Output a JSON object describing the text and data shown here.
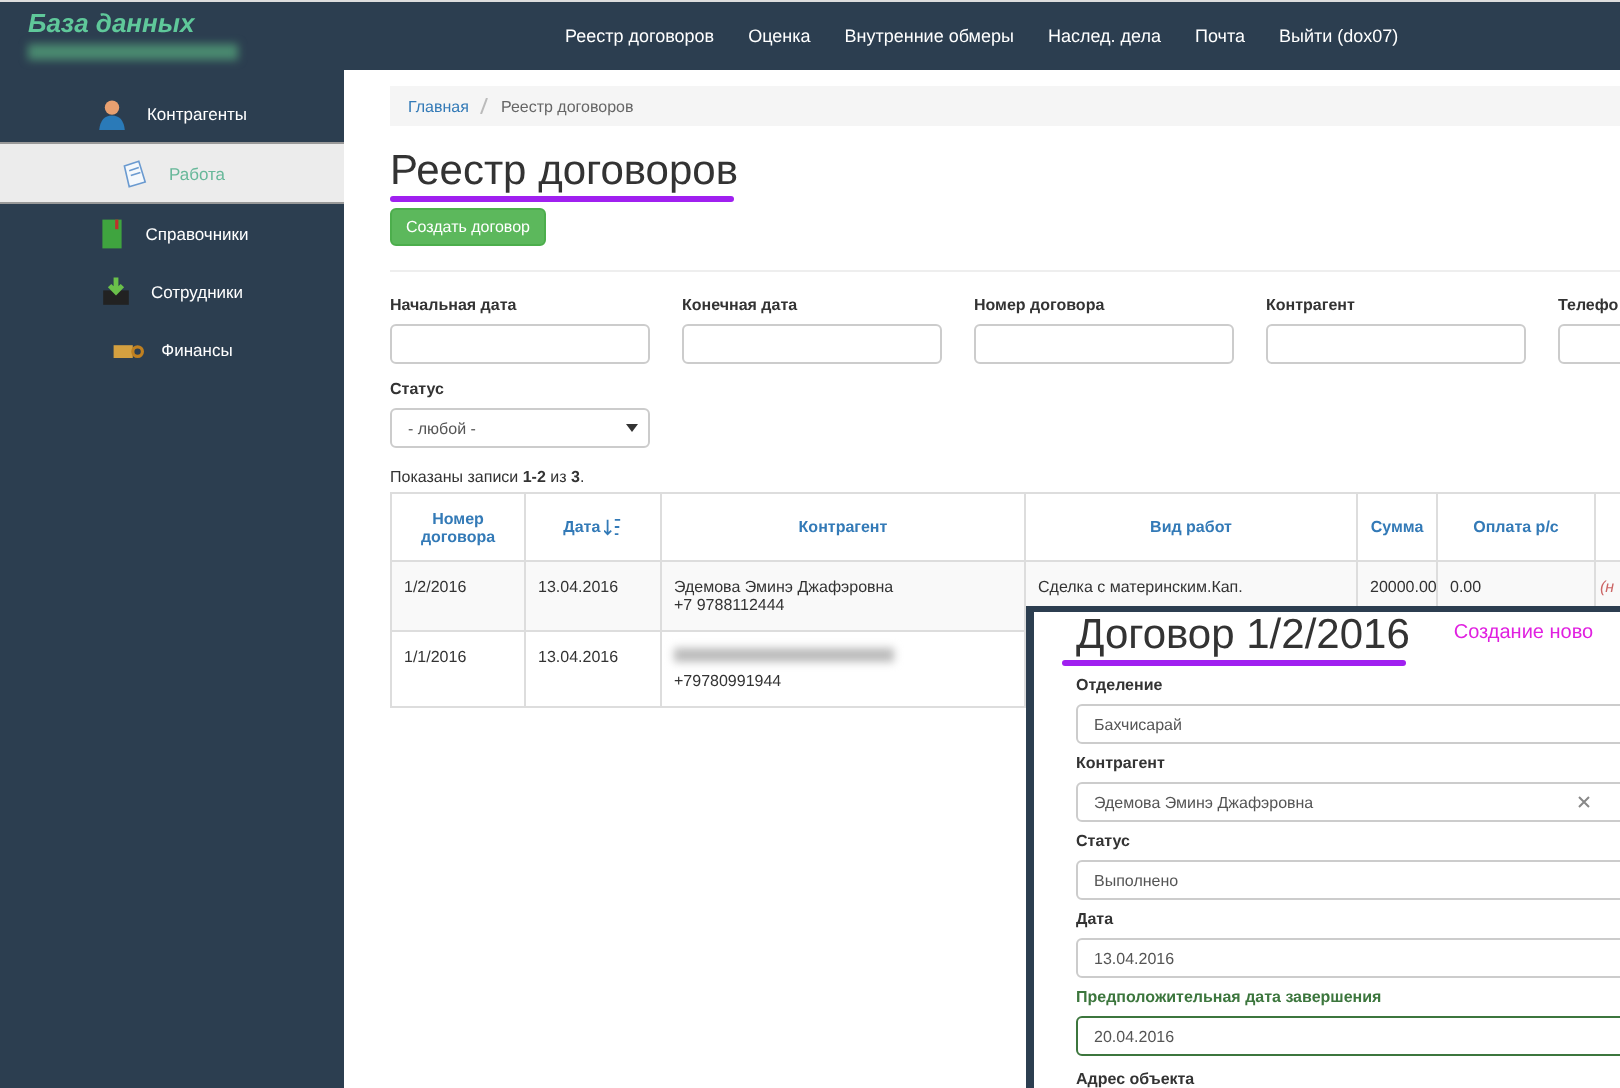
{
  "logo": {
    "title": "База данных"
  },
  "top_nav": [
    {
      "label": "Реестр договоров"
    },
    {
      "label": "Оценка"
    },
    {
      "label": "Внутренние обмеры"
    },
    {
      "label": "Наслед. дела"
    },
    {
      "label": "Почта"
    },
    {
      "label": "Выйти (dox07)"
    }
  ],
  "sidebar": {
    "items": [
      {
        "label": "Контрагенты",
        "kind": "person",
        "selected": false
      },
      {
        "label": "Работа",
        "kind": "note",
        "selected": true
      },
      {
        "label": "Справочники",
        "kind": "book",
        "selected": false
      },
      {
        "label": "Сотрудники",
        "kind": "inbox",
        "selected": false
      },
      {
        "label": "Финансы",
        "kind": "money",
        "selected": false
      }
    ]
  },
  "breadcrumb": [
    {
      "label": "Главная",
      "kind": "link"
    },
    {
      "label": "Реестр договоров",
      "kind": "current"
    }
  ],
  "heading": "Реестр договоров",
  "create_button": "Создать договор",
  "filters": [
    {
      "label": "Начальная дата"
    },
    {
      "label": "Конечная дата"
    },
    {
      "label": "Номер договора"
    },
    {
      "label": "Контрагент"
    },
    {
      "label": "Телефо"
    }
  ],
  "status_filter": {
    "label": "Статус",
    "value": "- любой -"
  },
  "summary": "Показаны записи **1-2** из **3**.",
  "table": {
    "columns": [
      {
        "label": "Номер договора",
        "sorted": false
      },
      {
        "label": "Дата",
        "sorted": true
      },
      {
        "label": "Контрагент",
        "sorted": false
      },
      {
        "label": "Вид работ",
        "sorted": false
      },
      {
        "label": "Сумма",
        "sorted": false
      },
      {
        "label": "Оплата р/с",
        "sorted": false
      }
    ],
    "rows": [
      {
        "cells": [
          "1/2/2016",
          "13.04.2016",
          "Эдемова Эминэ Джафэровна\n+7 9788112444",
          "Сделка с материнским.Кап.",
          "20000.00",
          "0.00",
          "(н"
        ],
        "redacted": false
      },
      {
        "cells": [
          "1/1/2016",
          "13.04.2016",
          "+79780991944"
        ],
        "redacted": true
      }
    ]
  },
  "contract_panel": {
    "title": "Договор 1/2/2016",
    "side_link": "Создание ново",
    "fields": [
      {
        "label": "Отделение",
        "value": "Бахчисарай",
        "kind": "select",
        "valid": false
      },
      {
        "label": "Контрагент",
        "value": "Эдемова Эминэ Джафэровна",
        "kind": "combo",
        "valid": false
      },
      {
        "label": "Статус",
        "value": "Выполнено",
        "kind": "select",
        "valid": false
      },
      {
        "label": "Дата",
        "value": "13.04.2016",
        "kind": "input",
        "valid": false
      },
      {
        "label": "Предположительная дата завершения",
        "value": "20.04.2016",
        "kind": "input",
        "valid": true
      }
    ],
    "last_label": "Адрес объекта"
  }
}
